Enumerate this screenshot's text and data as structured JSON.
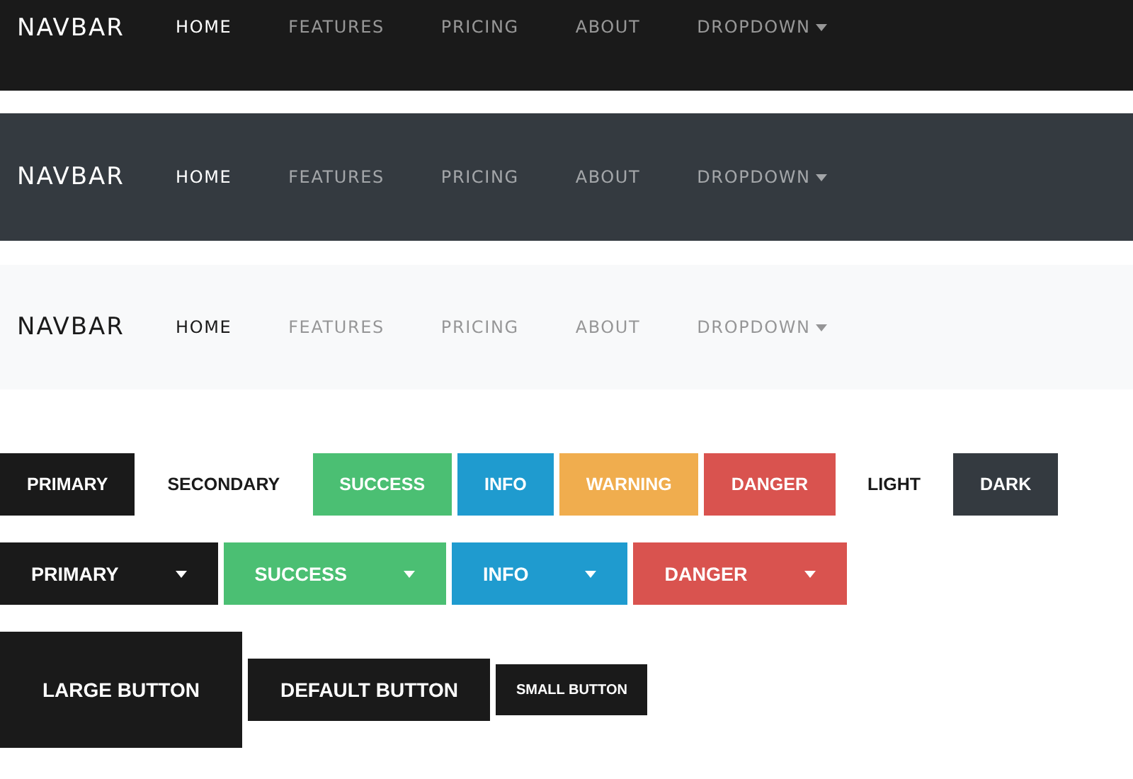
{
  "navbars": [
    {
      "kind": "black",
      "brand": "NAVBAR",
      "items": [
        {
          "label": "HOME",
          "selected": true
        },
        {
          "label": "FEATURES",
          "selected": false
        },
        {
          "label": "PRICING",
          "selected": false
        },
        {
          "label": "ABOUT",
          "selected": false
        },
        {
          "label": "DROPDOWN",
          "selected": false,
          "kind": "dropdown"
        }
      ]
    },
    {
      "kind": "dark",
      "brand": "NAVBAR",
      "items": [
        {
          "label": "HOME",
          "selected": true
        },
        {
          "label": "FEATURES",
          "selected": false
        },
        {
          "label": "PRICING",
          "selected": false
        },
        {
          "label": "ABOUT",
          "selected": false
        },
        {
          "label": "DROPDOWN",
          "selected": false,
          "kind": "dropdown"
        }
      ]
    },
    {
      "kind": "light",
      "brand": "NAVBAR",
      "items": [
        {
          "label": "HOME",
          "selected": true
        },
        {
          "label": "FEATURES",
          "selected": false
        },
        {
          "label": "PRICING",
          "selected": false
        },
        {
          "label": "ABOUT",
          "selected": false
        },
        {
          "label": "DROPDOWN",
          "selected": false,
          "kind": "dropdown"
        }
      ]
    }
  ],
  "buttons": [
    {
      "label": "PRIMARY",
      "kind": "primary"
    },
    {
      "label": "SECONDARY",
      "kind": "secondary"
    },
    {
      "label": "SUCCESS",
      "kind": "success"
    },
    {
      "label": "INFO",
      "kind": "info"
    },
    {
      "label": "WARNING",
      "kind": "warning"
    },
    {
      "label": "DANGER",
      "kind": "danger"
    },
    {
      "label": "LIGHT",
      "kind": "light"
    },
    {
      "label": "DARK",
      "kind": "dark"
    }
  ],
  "dropdown_buttons": [
    {
      "label": "PRIMARY",
      "kind": "primary"
    },
    {
      "label": "SUCCESS",
      "kind": "success"
    },
    {
      "label": "INFO",
      "kind": "info"
    },
    {
      "label": "DANGER",
      "kind": "danger"
    }
  ],
  "sized_buttons": [
    {
      "label": "LARGE BUTTON",
      "kind": "large"
    },
    {
      "label": "DEFAULT BUTTON",
      "kind": "default"
    },
    {
      "label": "SMALL BUTTON",
      "kind": "small"
    }
  ]
}
